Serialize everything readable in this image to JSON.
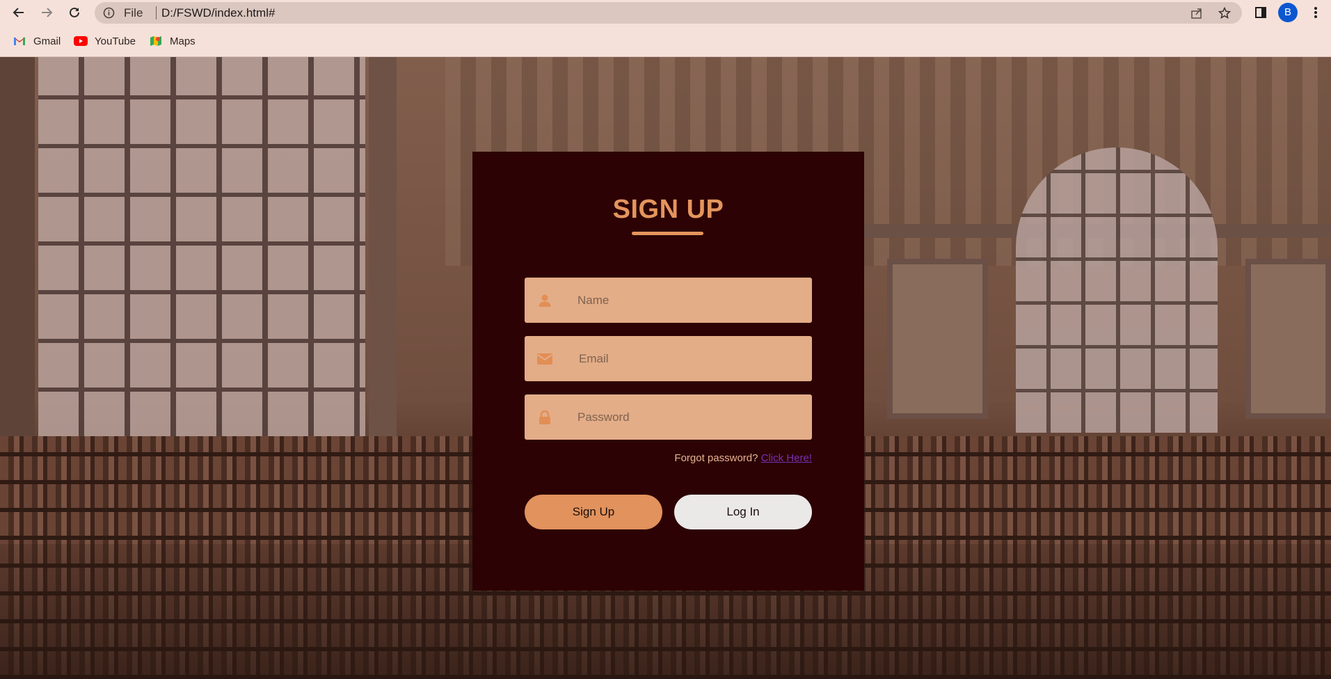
{
  "browser": {
    "nav": {
      "back_icon": "arrow-left-icon",
      "forward_icon": "arrow-right-icon",
      "reload_icon": "reload-icon"
    },
    "omnibox": {
      "scheme_label": "File",
      "url": "D:/FSWD/index.html#"
    },
    "profile_initial": "B",
    "bookmarks": [
      {
        "label": "Gmail",
        "icon": "gmail-icon"
      },
      {
        "label": "YouTube",
        "icon": "youtube-icon"
      },
      {
        "label": "Maps",
        "icon": "maps-icon"
      }
    ]
  },
  "form": {
    "title": "SIGN UP",
    "name_placeholder": "Name",
    "email_placeholder": "Email",
    "password_placeholder": "Password",
    "forgot_text": "Forgot password?",
    "forgot_link": "Click Here!",
    "signup_label": "Sign Up",
    "login_label": "Log In"
  },
  "colors": {
    "card_bg": "#2c0204",
    "accent": "#e4955d",
    "field_bg": "#e3ad88",
    "login_bg": "#ebe8e8",
    "chrome_bg": "#f5e1d9"
  }
}
